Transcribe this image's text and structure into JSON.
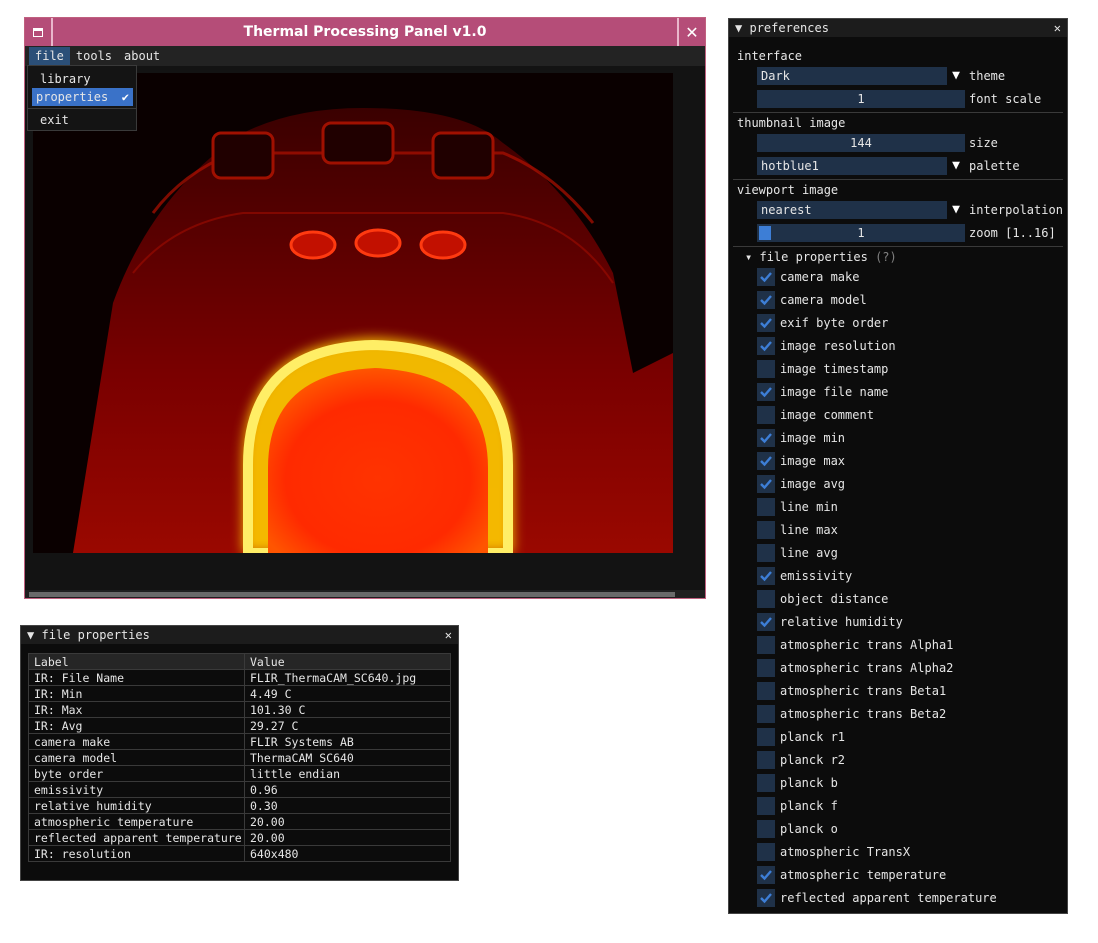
{
  "main_window": {
    "title": "Thermal Processing Panel v1.0",
    "close_symbol": "✕",
    "menu": [
      "file",
      "tools",
      "about"
    ],
    "file_menu": [
      "library",
      "properties",
      "exit"
    ],
    "check_symbol": "✔"
  },
  "file_properties": {
    "title": "file properties",
    "collapse_symbol": "▼",
    "close_symbol": "✕",
    "headers": [
      "Label",
      "Value"
    ],
    "rows": [
      [
        "IR: File Name",
        "FLIR_ThermaCAM_SC640.jpg"
      ],
      [
        "IR: Min",
        "4.49 C"
      ],
      [
        "IR: Max",
        "101.30 C"
      ],
      [
        "IR: Avg",
        "29.27 C"
      ],
      [
        "camera make",
        "FLIR Systems AB"
      ],
      [
        "camera model",
        "ThermaCAM SC640"
      ],
      [
        "byte order",
        "little endian"
      ],
      [
        "emissivity",
        "0.96"
      ],
      [
        "relative humidity",
        "0.30"
      ],
      [
        "atmospheric temperature",
        "20.00"
      ],
      [
        "reflected apparent temperature",
        "20.00"
      ],
      [
        "IR: resolution",
        "640x480"
      ]
    ]
  },
  "preferences": {
    "title": "preferences",
    "collapse_symbol": "▼",
    "close_symbol": "✕",
    "interface": {
      "heading": "interface",
      "theme_value": "Dark",
      "theme_label": "theme",
      "font_scale_value": "1",
      "font_scale_label": "font scale"
    },
    "thumbnail": {
      "heading": "thumbnail image",
      "size_value": "144",
      "size_label": "size",
      "palette_value": "hotblue1",
      "palette_label": "palette"
    },
    "viewport": {
      "heading": "viewport image",
      "interp_value": "nearest",
      "interp_label": "interpolation",
      "zoom_value": "1",
      "zoom_label": "zoom [1..16]"
    },
    "file_props": {
      "heading": "file properties",
      "help": "(?)",
      "items": [
        {
          "label": "camera make",
          "checked": true
        },
        {
          "label": "camera model",
          "checked": true
        },
        {
          "label": "exif byte order",
          "checked": true
        },
        {
          "label": "image resolution",
          "checked": true
        },
        {
          "label": "image timestamp",
          "checked": false
        },
        {
          "label": "image file name",
          "checked": true
        },
        {
          "label": "image comment",
          "checked": false
        },
        {
          "label": "image min",
          "checked": true
        },
        {
          "label": "image max",
          "checked": true
        },
        {
          "label": "image avg",
          "checked": true
        },
        {
          "label": "line min",
          "checked": false
        },
        {
          "label": "line max",
          "checked": false
        },
        {
          "label": "line avg",
          "checked": false
        },
        {
          "label": "emissivity",
          "checked": true
        },
        {
          "label": "object distance",
          "checked": false
        },
        {
          "label": "relative humidity",
          "checked": true
        },
        {
          "label": "atmospheric trans Alpha1",
          "checked": false
        },
        {
          "label": "atmospheric trans Alpha2",
          "checked": false
        },
        {
          "label": "atmospheric trans Beta1",
          "checked": false
        },
        {
          "label": "atmospheric trans Beta2",
          "checked": false
        },
        {
          "label": "planck r1",
          "checked": false
        },
        {
          "label": "planck r2",
          "checked": false
        },
        {
          "label": "planck b",
          "checked": false
        },
        {
          "label": "planck f",
          "checked": false
        },
        {
          "label": "planck o",
          "checked": false
        },
        {
          "label": "atmospheric TransX",
          "checked": false
        },
        {
          "label": "atmospheric temperature",
          "checked": true
        },
        {
          "label": "reflected apparent temperature",
          "checked": true
        }
      ]
    }
  },
  "colors": {
    "accent": "#3d7ed6",
    "titlebar": "#b54d78",
    "frame_bg": "#1f3148"
  }
}
